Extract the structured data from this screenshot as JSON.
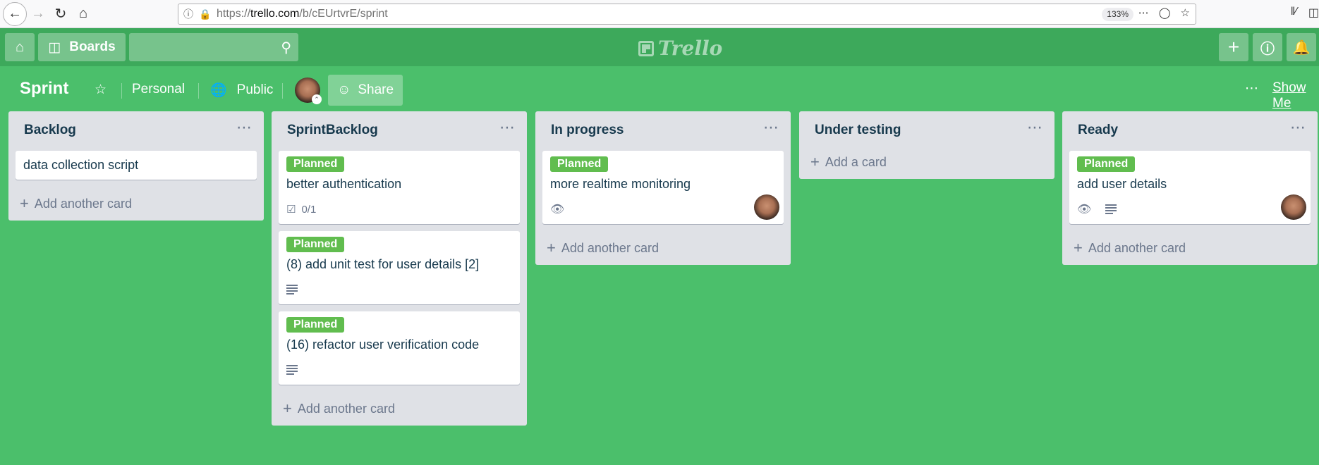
{
  "browser": {
    "url_prefix": "https://",
    "url_host": "trello.com",
    "url_path": "/b/cEUrtvrE/sprint",
    "zoom": "133%"
  },
  "header": {
    "boards_label": "Boards",
    "logo_text": "Trello"
  },
  "board": {
    "title": "Sprint",
    "team_label": "Personal",
    "visibility_label": "Public",
    "share_label": "Share",
    "show_menu_label": "Show Me"
  },
  "lists": [
    {
      "title": "Backlog",
      "cards": [
        {
          "title": "data collection script"
        }
      ],
      "add_label": "Add another card"
    },
    {
      "title": "SprintBacklog",
      "cards": [
        {
          "label": "Planned",
          "title": "better authentication",
          "checklist": "0/1"
        },
        {
          "label": "Planned",
          "title": "(8) add unit test for user details [2]"
        },
        {
          "label": "Planned",
          "title": "(16) refactor user verification code"
        }
      ],
      "add_label": "Add another card"
    },
    {
      "title": "In progress",
      "cards": [
        {
          "label": "Planned",
          "title": "more realtime monitoring"
        }
      ],
      "add_label": "Add another card"
    },
    {
      "title": "Under testing",
      "cards": [],
      "add_label": "Add a card"
    },
    {
      "title": "Ready",
      "cards": [
        {
          "label": "Planned",
          "title": "add user details"
        }
      ],
      "add_label": "Add another card"
    }
  ],
  "colors": {
    "board_bg": "#4bbf6b",
    "header_bg": "#3da95b",
    "label_green": "#61bd4f",
    "list_bg": "#dfe1e6"
  }
}
